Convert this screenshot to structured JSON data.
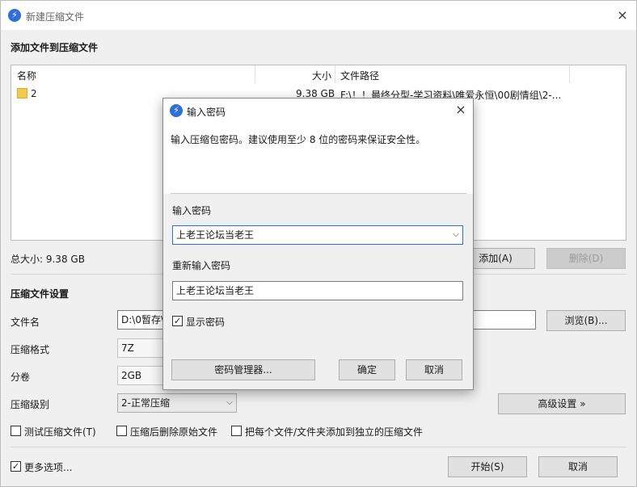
{
  "window": {
    "title": "新建压缩文件",
    "close": "×"
  },
  "section_add": {
    "heading": "添加文件到压缩文件"
  },
  "file_list": {
    "columns": {
      "name": "名称",
      "size": "大小",
      "path": "文件路径"
    },
    "rows": [
      {
        "name": "2",
        "size": "9.38 GB",
        "path": "F:\\！！最终分型-学习资料\\唯爱永恒\\00剧情组\\2-..."
      }
    ]
  },
  "total": {
    "label": "总大小: 9.38 GB"
  },
  "buttons": {
    "add": "添加(A)",
    "delete": "删除(D)",
    "browse": "浏览(B)...",
    "advanced": "高级设置 »",
    "start": "开始(S)",
    "cancel": "取消"
  },
  "section_settings": {
    "heading": "压缩文件设置",
    "filename_label": "文件名",
    "filename_value": "D:\\0暂存\\",
    "format_label": "压缩格式",
    "format_value": "7Z",
    "volume_label": "分卷",
    "volume_value": "2GB",
    "level_label": "压缩级别",
    "level_value": "2-正常压缩"
  },
  "options": {
    "test": {
      "label": "测试压缩文件(T)",
      "checked": false
    },
    "delete_after": {
      "label": "压缩后删除原始文件",
      "checked": false
    },
    "separate": {
      "label": "把每个文件/文件夹添加到独立的压缩文件",
      "checked": false
    },
    "more": {
      "label": "更多选项...",
      "checked": true
    }
  },
  "dialog": {
    "title": "输入密码",
    "close": "×",
    "intro": "输入压缩包密码。建议使用至少 8 位的密码来保证安全性。",
    "password_label": "输入密码",
    "password_value": "上老王论坛当老王",
    "reenter_label": "重新输入密码",
    "reenter_value": "上老王论坛当老王",
    "show_password": {
      "label": "显示密码",
      "checked": true
    },
    "manager_button": "密码管理器...",
    "ok_button": "确定",
    "cancel_button": "取消"
  },
  "icons": {
    "app": "app-logo-icon",
    "folder": "folder-icon",
    "dropdown": "chevron-down-icon",
    "check": "✓"
  },
  "colors": {
    "accent": "#2f6fd6",
    "folder": "#f2c94c",
    "focus_border": "#2f6fd6"
  }
}
